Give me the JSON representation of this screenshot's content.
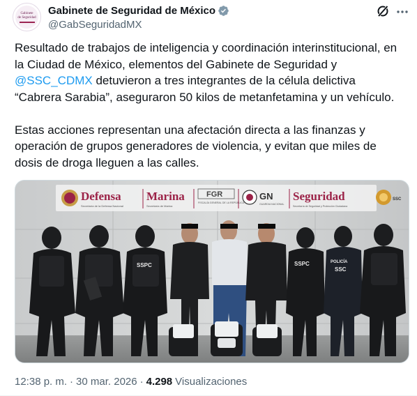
{
  "author": {
    "display_name": "Gabinete de Seguridad de México",
    "handle": "@GabSeguridadMX",
    "avatar_text": [
      "Gabinete",
      "de Seguridad"
    ],
    "verified_badge_color": "#829aab"
  },
  "post": {
    "paragraph1_before_mention": "Resultado de trabajos de inteligencia y coordinación interinstitucional, en la Ciudad de México, elementos del Gabinete de Seguridad y ",
    "mention": "@SSC_CDMX",
    "paragraph1_after_mention": " detuvieron a tres integrantes de la célula delictiva “Cabrera Sarabia”, aseguraron 50 kilos de metanfetamina y un vehículo.",
    "paragraph2": "Estas acciones representan una afectación directa a las finanzas y operación de grupos generadores de violencia, y evitan que miles de dosis de droga lleguen a las calles."
  },
  "media": {
    "banner": {
      "defensa": "Defensa",
      "defensa_sub": "Secretaría de la Defensa Nacional",
      "marina": "Marina",
      "marina_sub": "Secretaría de Marina",
      "fgr": "FGR",
      "fgr_sub": "FISCALÍA GENERAL DE LA REPÚBLICA",
      "gn": "GN",
      "gn_sub": "GUARDIA NACIONAL",
      "seguridad": "Seguridad",
      "seguridad_sub": "Secretaría de Seguridad y Protección Ciudadana",
      "ssc": "SSC"
    },
    "vest_labels": {
      "sspc_1": "SSPC",
      "sspc_2": "SSPC",
      "policia": "POLICÍA",
      "ssc": "SSC"
    },
    "accent_colors": {
      "guinda": "#9b2247",
      "gold": "#a57f2c"
    }
  },
  "meta": {
    "time": "12:38 p. m.",
    "date": "30 mar. 2026",
    "views_count": "4.298",
    "views_label": "Visualizaciones"
  }
}
